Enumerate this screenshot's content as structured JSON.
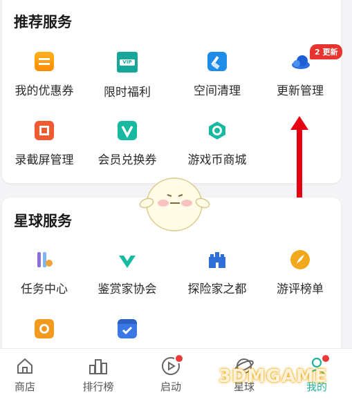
{
  "recommend": {
    "title": "推荐服务",
    "items": [
      {
        "label": "我的优惠券",
        "icon": "coupon-icon"
      },
      {
        "label": "限时福利",
        "icon": "vip-gift-icon",
        "icon_text": "VIP"
      },
      {
        "label": "空间清理",
        "icon": "broom-icon"
      },
      {
        "label": "更新管理",
        "icon": "cloud-icon"
      },
      {
        "label": "录截屏管理",
        "icon": "screen-record-icon"
      },
      {
        "label": "会员兑换券",
        "icon": "member-voucher-icon"
      },
      {
        "label": "游戏币商城",
        "icon": "game-coin-icon"
      }
    ],
    "update_badge": "2 更新"
  },
  "planet": {
    "title": "星球服务",
    "items": [
      {
        "label": "任务中心",
        "icon": "task-keys-icon"
      },
      {
        "label": "鉴赏家协会",
        "icon": "connoisseur-icon"
      },
      {
        "label": "探险家之都",
        "icon": "castle-icon"
      },
      {
        "label": "游评榜单",
        "icon": "review-feather-icon"
      },
      {
        "label": "",
        "icon": "alarm-clock-icon"
      },
      {
        "label": "",
        "icon": "calendar-check-icon"
      }
    ]
  },
  "tabbar": {
    "tabs": [
      {
        "label": "商店",
        "icon": "home-icon"
      },
      {
        "label": "排行榜",
        "icon": "ranking-icon"
      },
      {
        "label": "启动",
        "icon": "play-icon"
      },
      {
        "label": "星球",
        "icon": "planet-icon"
      },
      {
        "label": "我的",
        "icon": "profile-icon"
      }
    ],
    "active": "我的"
  },
  "watermark": "3DMGAME",
  "colors": {
    "accent": "#1bb29a",
    "badge": "#e8342e",
    "arrow": "#e60012"
  }
}
